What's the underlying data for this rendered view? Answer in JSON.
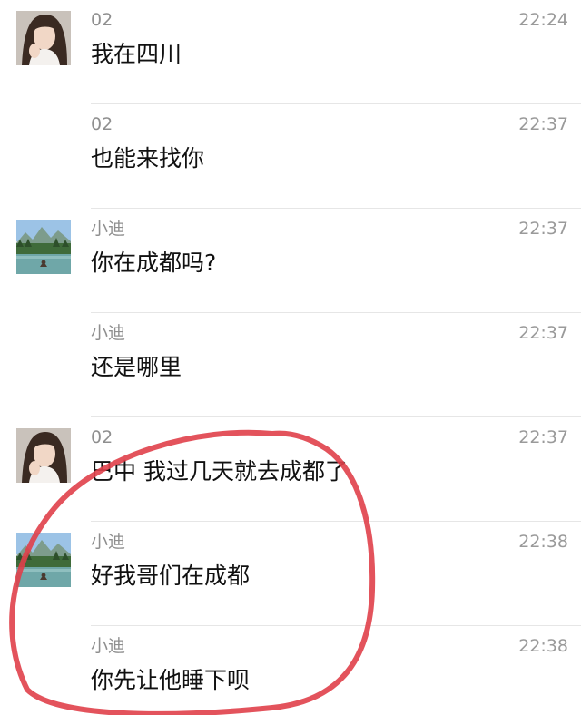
{
  "messages": [
    {
      "sender": "02",
      "time": "22:24",
      "text": "我在四川",
      "avatar": "woman-portrait",
      "show_avatar": true
    },
    {
      "sender": "02",
      "time": "22:37",
      "text": "也能来找你",
      "avatar": "woman-portrait",
      "show_avatar": false
    },
    {
      "sender": "小迪",
      "time": "22:37",
      "text": "你在成都吗?",
      "avatar": "mountain-lake-landscape",
      "show_avatar": true
    },
    {
      "sender": "小迪",
      "time": "22:37",
      "text": "还是哪里",
      "avatar": "mountain-lake-landscape",
      "show_avatar": false
    },
    {
      "sender": "02",
      "time": "22:37",
      "text": "巴中 我过几天就去成都了",
      "avatar": "woman-portrait",
      "show_avatar": true
    },
    {
      "sender": "小迪",
      "time": "22:38",
      "text": "好我哥们在成都",
      "avatar": "mountain-lake-landscape",
      "show_avatar": true
    },
    {
      "sender": "小迪",
      "time": "22:38",
      "text": "你先让他睡下呗",
      "avatar": "mountain-lake-landscape",
      "show_avatar": false
    }
  ],
  "colors": {
    "sender_text": "#8f8f8f",
    "time_text": "#9a9a9a",
    "message_text": "#111111",
    "divider": "#e6e6e6",
    "annotation_circle": "#e0404a"
  }
}
